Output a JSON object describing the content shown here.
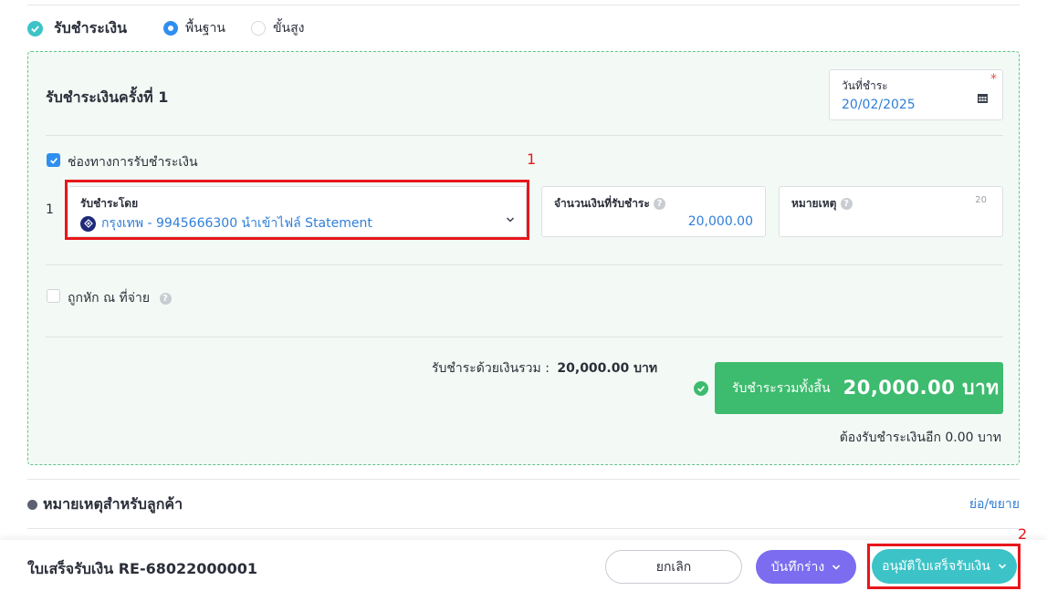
{
  "payment_section": {
    "title": "รับชำระเงิน",
    "modes": [
      {
        "label": "พื้นฐาน",
        "selected": true
      },
      {
        "label": "ขั้นสูง",
        "selected": false
      }
    ]
  },
  "installment": {
    "title": "รับชำระเงินครั้งที่ 1",
    "date_label": "วันที่ชำระ",
    "date_value": "20/02/2025",
    "required_mark": "*"
  },
  "channel": {
    "checkbox_label": "ช่องทางการรับชำระเงิน",
    "checked": true,
    "row_index": "1",
    "paid_by_label": "รับชำระโดย",
    "paid_by_value": "กรุงเทพ - 9945666300 นำเข้าไฟล์ Statement",
    "amount_label": "จำนวนเงินที่รับชำระ",
    "amount_value": "20,000.00",
    "note_label": "หมายเหตุ",
    "note_counter": "20"
  },
  "withholding": {
    "label": "ถูกหัก ณ ที่จ่าย",
    "checked": false
  },
  "summary": {
    "total_label": "รับชำระด้วยเงินรวม :",
    "total_value": "20,000.00 บาท",
    "grand_label": "รับชำระรวมทั้งสิ้น",
    "grand_value": "20,000.00 บาท",
    "remaining": "ต้องรับชำระเงินอีก 0.00 บาท"
  },
  "annotations": {
    "marker_1": "1",
    "marker_2": "2"
  },
  "notes": {
    "title": "หมายเหตุสำหรับลูกค้า",
    "toggle": "ย่อ/ขยาย"
  },
  "footer": {
    "doc_title": "ใบเสร็จรับเงิน RE-68022000001",
    "cancel": "ยกเลิก",
    "save_draft": "บันทึกร่าง",
    "approve": "อนุมัติใบเสร็จรับเงิน"
  },
  "colors": {
    "accent_teal": "#3cc3c7",
    "primary_blue": "#2f8ff0",
    "success_green": "#3dbb6e",
    "draft_purple": "#7b6cf0",
    "highlight_red": "#e8161b"
  }
}
